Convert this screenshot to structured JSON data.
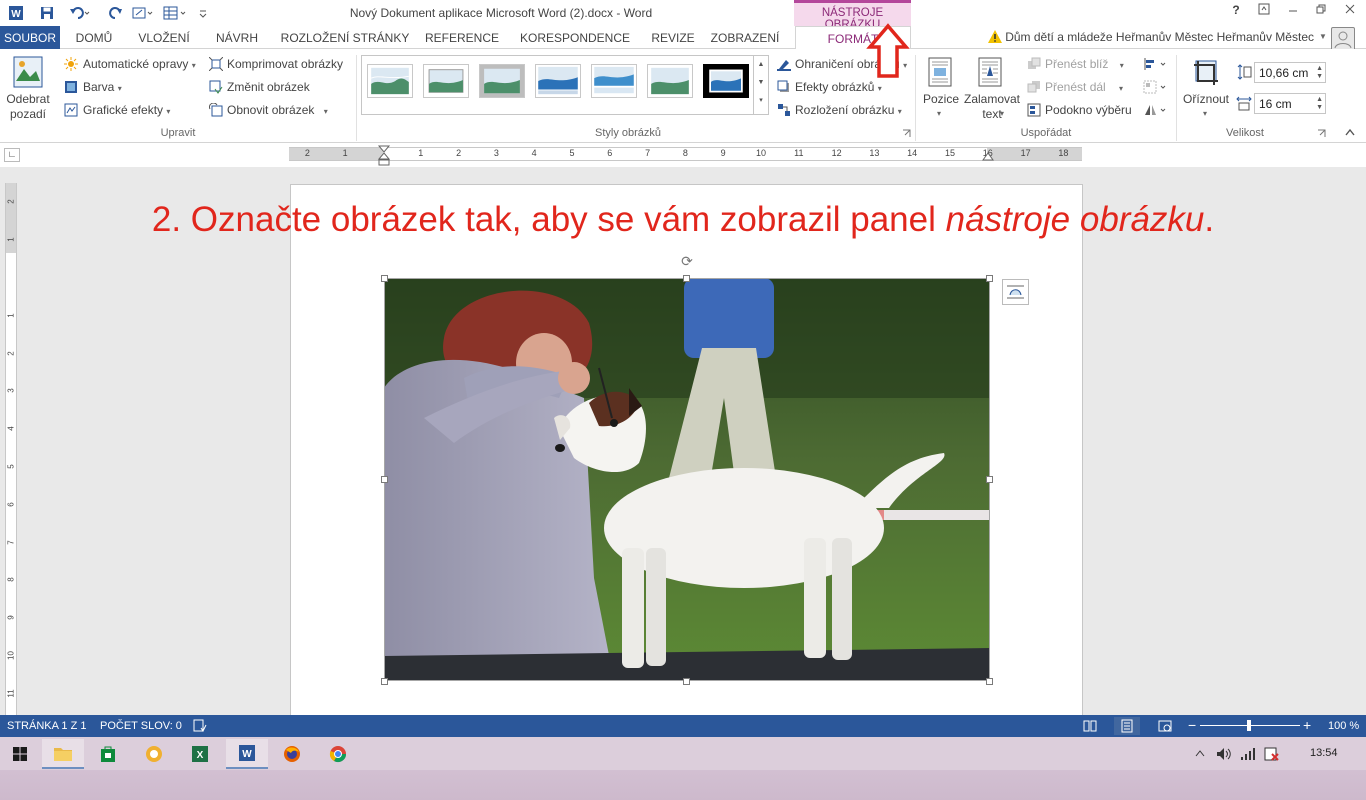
{
  "window": {
    "title": "Nový Dokument aplikace Microsoft Word (2).docx - Word",
    "context_header": "NÁSTROJE OBRÁZKU",
    "help": "?",
    "user": "Dům dětí a mládeže Heřmanův Městec Heřmanův Městec"
  },
  "tabs": [
    "SOUBOR",
    "DOMŮ",
    "VLOŽENÍ",
    "NÁVRH",
    "ROZLOŽENÍ STRÁNKY",
    "REFERENCE",
    "KORESPONDENCE",
    "REVIZE",
    "ZOBRAZENÍ",
    "FORMÁT"
  ],
  "ribbon": {
    "upravit": {
      "remove_bg": "Odebrat pozadí",
      "auto_corrections": "Automatické opravy",
      "color": "Barva",
      "artistic": "Grafické efekty",
      "compress": "Komprimovat obrázky",
      "change": "Změnit obrázek",
      "reset": "Obnovit obrázek",
      "label": "Upravit"
    },
    "styles": {
      "label": "Styly obrázků",
      "border": "Ohraničení obrázku",
      "effects": "Efekty obrázků",
      "layout": "Rozložení obrázku"
    },
    "arrange": {
      "position": "Pozice",
      "wrap": "Zalamovat text",
      "forward": "Přenést blíž",
      "backward": "Přenést dál",
      "selection_pane": "Podokno výběru",
      "label": "Uspořádat"
    },
    "size": {
      "crop": "Oříznout",
      "height": "10,66 cm",
      "width": "16 cm",
      "label": "Velikost"
    }
  },
  "ruler": {
    "numbers": [
      "2",
      "1",
      "1",
      "2",
      "3",
      "4",
      "5",
      "6",
      "7",
      "8",
      "9",
      "10",
      "11",
      "12",
      "13",
      "14",
      "15",
      "16",
      "17",
      "18"
    ],
    "vnumbers": [
      "2",
      "1",
      "1",
      "2",
      "3",
      "4",
      "5",
      "6",
      "7",
      "8",
      "9",
      "10",
      "11"
    ]
  },
  "document": {
    "instruction_prefix": "2. Označte obrázek tak, aby se vám zobrazil panel ",
    "instruction_italic": "nástroje obrázku",
    "instruction_suffix": "."
  },
  "status": {
    "page": "STRÁNKA 1 Z 1",
    "words": "POČET SLOV: 0",
    "zoom": "100 %",
    "zoom_minus": "−",
    "zoom_plus": "+"
  },
  "taskbar": {
    "time": "13:54"
  },
  "colors": {
    "word_blue": "#2b579a",
    "context_pink": "#b4479b",
    "instruction_red": "#e1261c"
  }
}
